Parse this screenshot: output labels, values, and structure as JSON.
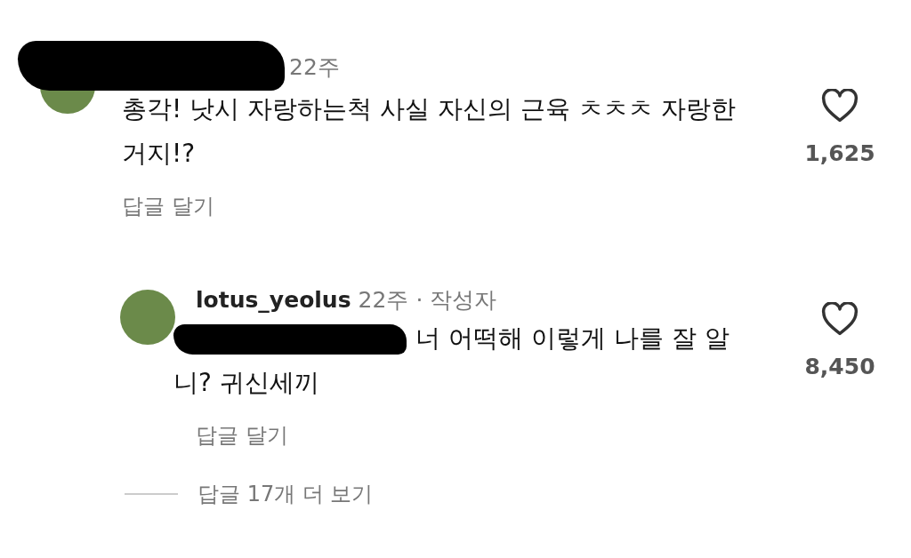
{
  "comments": [
    {
      "username_redacted": true,
      "time": "22주",
      "text": "총각! 낫시 자랑하는척 사실 자신의 근육 ㅊㅊㅊ 자랑한거지!?",
      "reply_label": "답글 달기",
      "likes": "1,625"
    }
  ],
  "replies": [
    {
      "username": "lotus_yeolus",
      "time": "22주",
      "separator": "·",
      "author_badge": "작성자",
      "mention_redacted": true,
      "text": "너 어떡해 이렇게 나를 잘 알니? 귀신세끼",
      "reply_label": "답글 달기",
      "likes": "8,450"
    }
  ],
  "more_replies": "답글 17개 더 보기"
}
